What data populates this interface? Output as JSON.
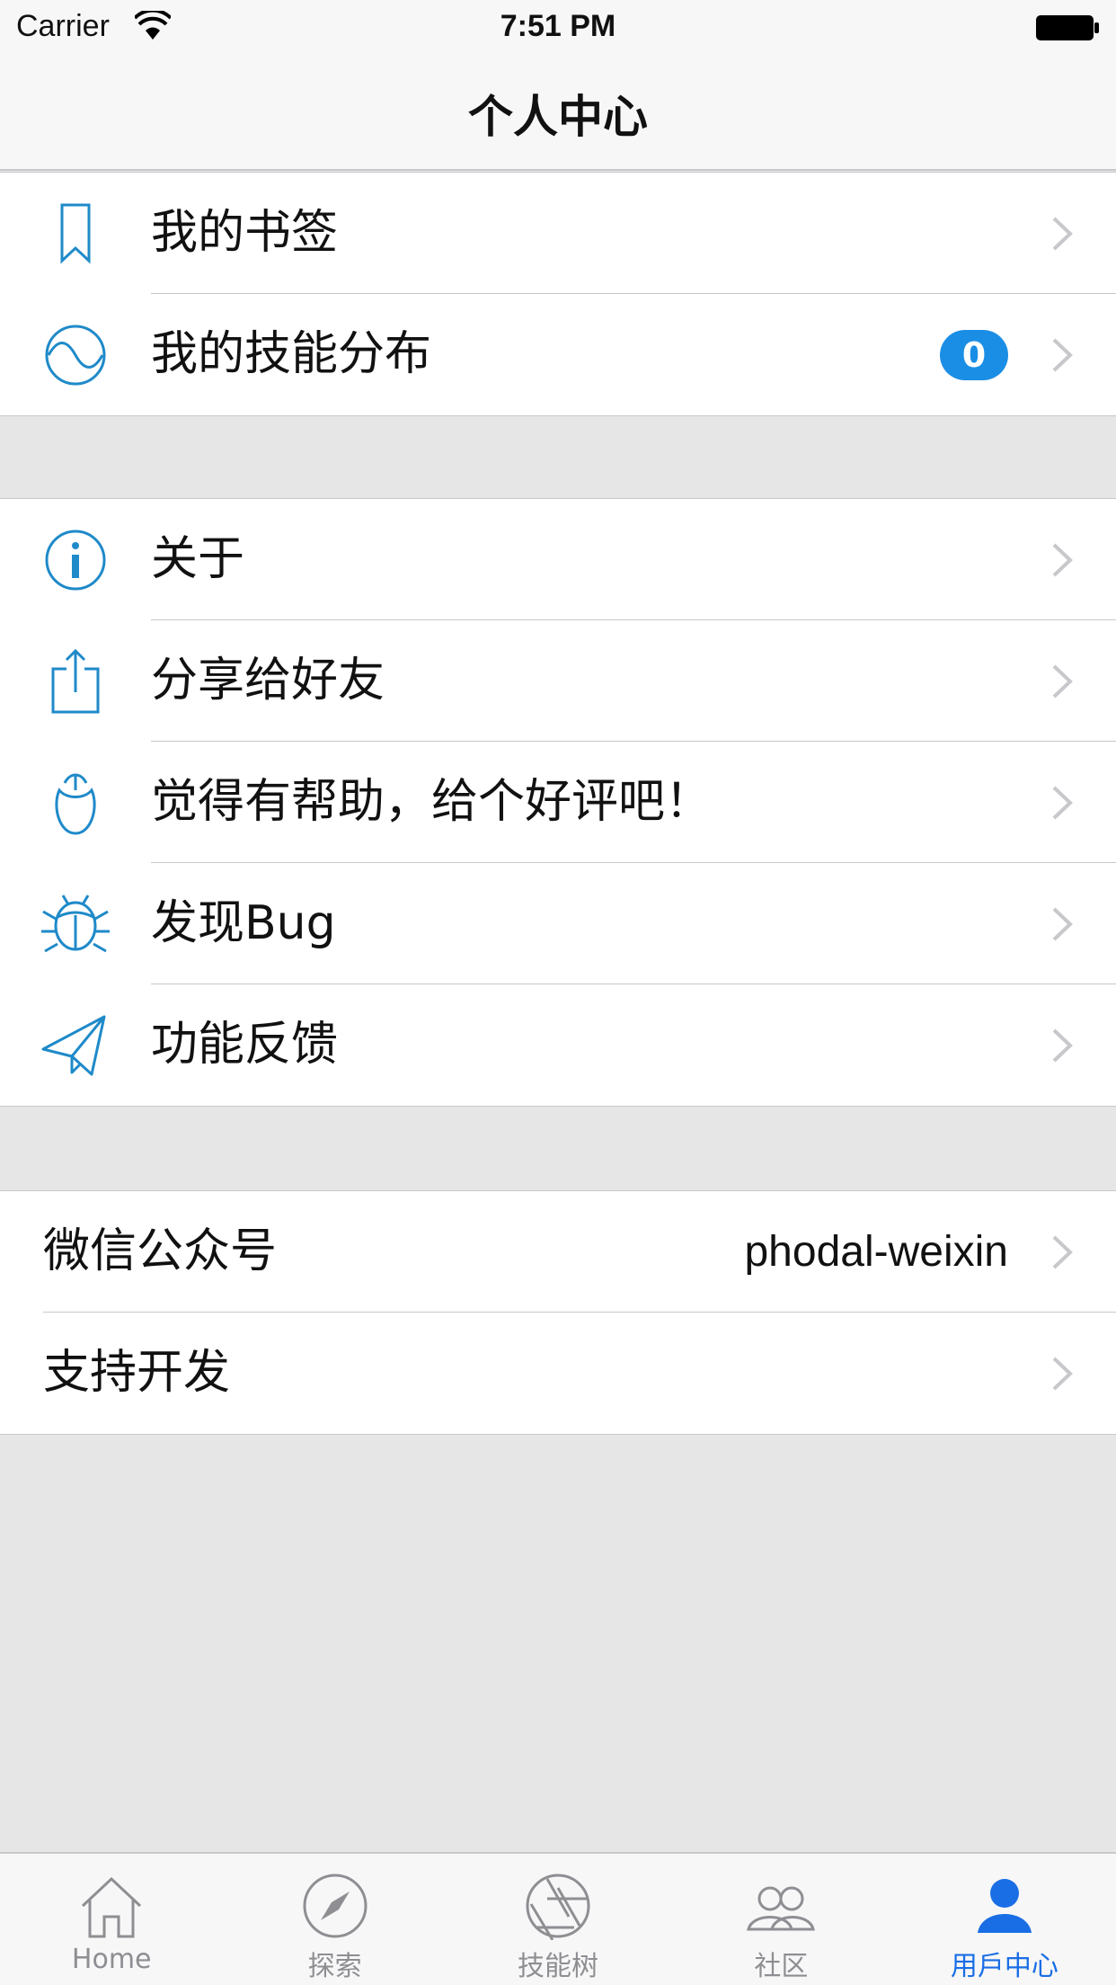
{
  "status_bar": {
    "carrier": "Carrier",
    "time": "7:51 PM"
  },
  "nav": {
    "title": "个人中心"
  },
  "group1": [
    {
      "label": "我的书签",
      "icon": "bookmark-icon"
    },
    {
      "label": "我的技能分布",
      "icon": "wave-icon",
      "badge": "0"
    }
  ],
  "group2": [
    {
      "label": "关于",
      "icon": "info-icon"
    },
    {
      "label": "分享给好友",
      "icon": "share-icon"
    },
    {
      "label": "觉得有帮助，给个好评吧！",
      "icon": "flower-icon"
    },
    {
      "label": "发现Bug",
      "icon": "bug-icon"
    },
    {
      "label": "功能反馈",
      "icon": "paper-plane-icon"
    }
  ],
  "group3": [
    {
      "label": "微信公众号",
      "detail": "phodal-weixin"
    },
    {
      "label": "支持开发"
    }
  ],
  "tabs": [
    {
      "label": "Home",
      "icon": "home-icon"
    },
    {
      "label": "探索",
      "icon": "compass-icon"
    },
    {
      "label": "技能树",
      "icon": "aperture-icon"
    },
    {
      "label": "社区",
      "icon": "community-icon"
    },
    {
      "label": "用戶中心",
      "icon": "user-icon",
      "active": true
    }
  ],
  "colors": {
    "accent": "#1a8ee5",
    "icon": "#1f8ac9",
    "tab_active": "#1a6ee5",
    "tab_inactive": "#8e8e93"
  }
}
